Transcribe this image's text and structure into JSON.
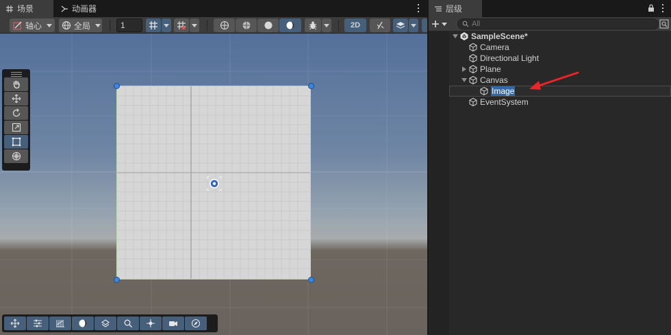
{
  "scene_window": {
    "tab_scene": "场景",
    "tab_animator": "动画器",
    "toolbar": {
      "pivot_label": "轴心",
      "global_label": "全局",
      "grid_size_value": "1",
      "mode_2d_label": "2D"
    }
  },
  "hierarchy": {
    "tab_label": "层级",
    "search_placeholder": "All",
    "items": [
      {
        "label": "SampleScene*",
        "type": "scene",
        "expanded": true
      },
      {
        "label": "Camera",
        "type": "gameobject"
      },
      {
        "label": "Directional Light",
        "type": "gameobject"
      },
      {
        "label": "Plane",
        "type": "gameobject",
        "expanded": false
      },
      {
        "label": "Canvas",
        "type": "gameobject",
        "expanded": true
      },
      {
        "label": "Image",
        "type": "gameobject",
        "selected": true
      },
      {
        "label": "EventSystem",
        "type": "gameobject"
      }
    ]
  },
  "colors": {
    "selection_blue": "#3467a6",
    "active_tool_blue": "#46607c",
    "annotation_arrow": "#e8262a",
    "handle_blue": "#3a86e0"
  },
  "icons": {
    "scene_tab": "grid-hash-icon",
    "animator_tab": "animator-connect-icon",
    "hierarchy_tab": "list-lines-icon",
    "lock": "lock-icon",
    "create": "plus-icon",
    "search": "search-icon",
    "gameobject": "cube-icon",
    "scene": "unity-logo-icon"
  }
}
